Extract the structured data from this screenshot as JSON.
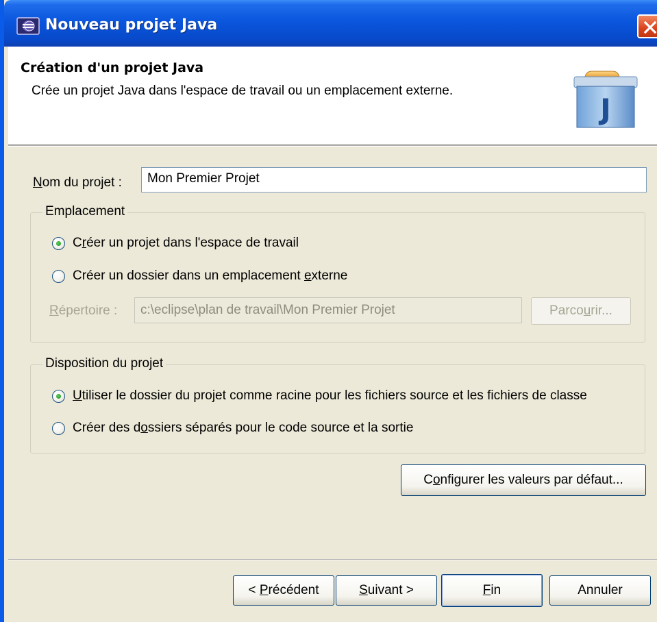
{
  "window": {
    "title": "Nouveau projet Java"
  },
  "banner": {
    "title": "Création d'un projet Java",
    "description": "Crée un projet Java dans l'espace de travail ou un emplacement externe.",
    "icon_letter": "J"
  },
  "project_name": {
    "label": "Nom du projet :",
    "value": "Mon Premier Projet"
  },
  "location_group": {
    "legend": "Emplacement",
    "option_workspace": "Créer un projet dans l'espace de travail",
    "option_external": "Créer un dossier dans un emplacement externe",
    "selected": "workspace",
    "directory_label": "Répertoire :",
    "directory_value": "c:\\eclipse\\plan de travail\\Mon Premier Projet",
    "browse_label": "Parcourir..."
  },
  "layout_group": {
    "legend": "Disposition du projet",
    "option_project_root": "Utiliser le dossier du projet comme racine pour les fichiers source et les fichiers de classe",
    "option_separate": "Créer des dossiers séparés pour le code source et la sortie",
    "selected": "project_root"
  },
  "configure_defaults_label": "Configurer les valeurs par défaut...",
  "footer": {
    "previous": "< Précédent",
    "next": "Suivant >",
    "finish": "Fin",
    "cancel": "Annuler"
  },
  "colors": {
    "titlebar": "#0A56DE",
    "dialog_bg": "#ECE9D8",
    "close_button": "#D9431E"
  }
}
